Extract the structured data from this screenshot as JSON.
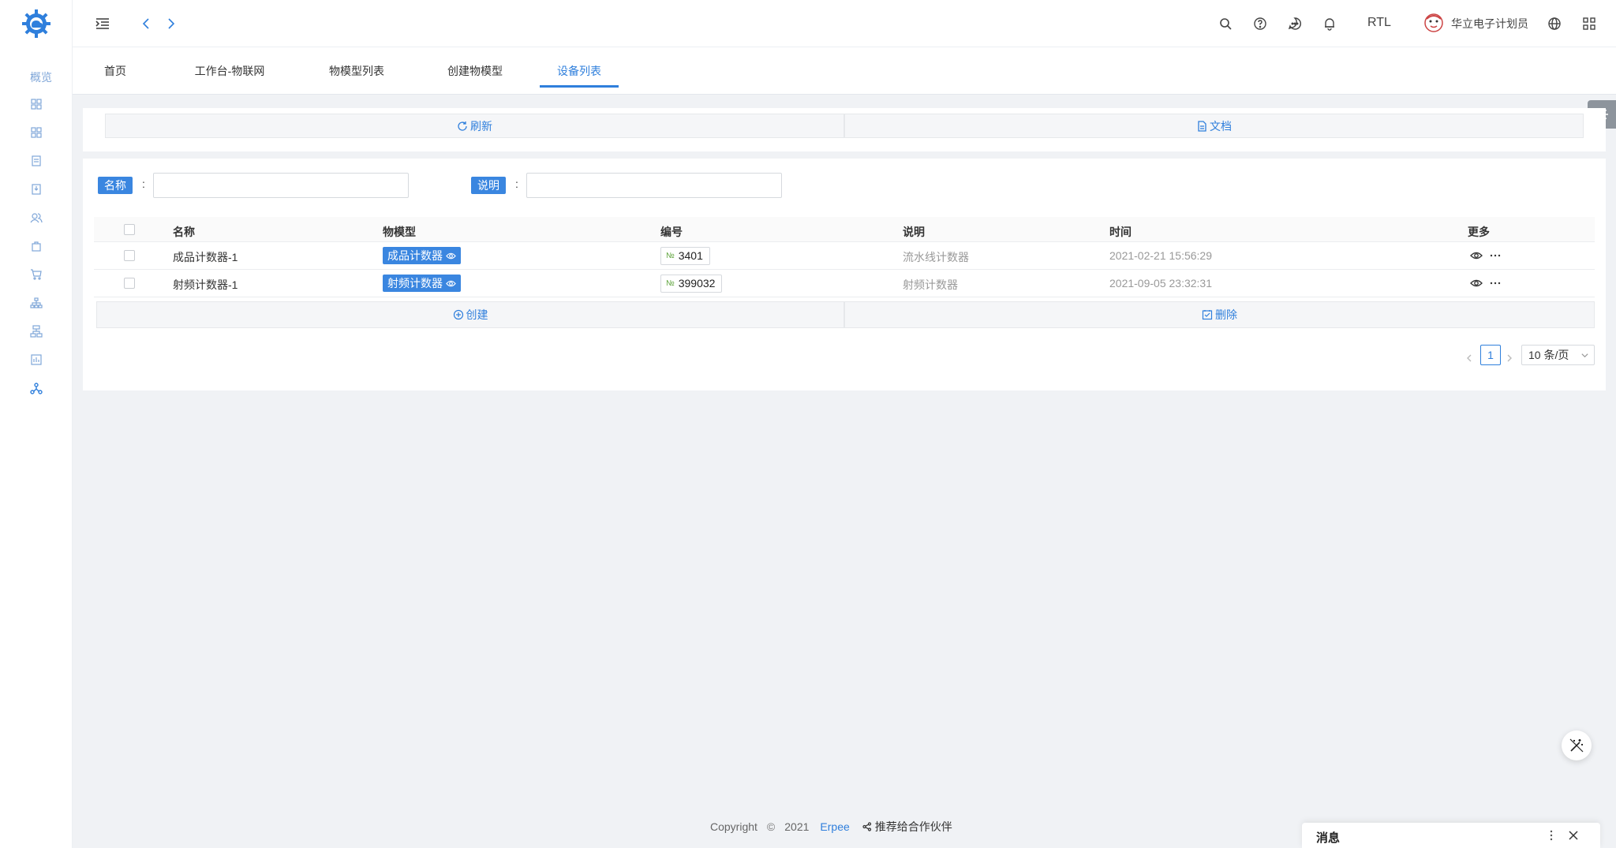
{
  "colors": {
    "primary": "#2f7fdc",
    "tag": "#3a86e0",
    "background": "#f0f2f5"
  },
  "sidebar": {
    "overview_label": "概览",
    "icons": [
      "dashboard-icon",
      "grid-icon",
      "document-icon",
      "download-icon",
      "users-icon",
      "bag-icon",
      "cart-icon",
      "org-icon",
      "structure-icon",
      "chart-icon",
      "network-icon"
    ]
  },
  "header": {
    "rtl_label": "RTL",
    "user_name": "华立电子计划员"
  },
  "tabs": [
    {
      "label": "首页"
    },
    {
      "label": "工作台-物联网"
    },
    {
      "label": "物模型列表"
    },
    {
      "label": "创建物模型"
    },
    {
      "label": "设备列表",
      "active": true
    }
  ],
  "toolbar": {
    "refresh_label": "刷新",
    "docs_label": "文档"
  },
  "filters": {
    "name_label": "名称",
    "name_value": "",
    "desc_label": "说明",
    "desc_value": "",
    "colon": ":"
  },
  "table": {
    "columns": [
      "名称",
      "物模型",
      "编号",
      "说明",
      "时间",
      "更多"
    ],
    "rows": [
      {
        "name": "成品计数器-1",
        "model": "成品计数器",
        "code_prefix": "№",
        "code": "3401",
        "desc": "流水线计数器",
        "time": "2021-02-21 15:56:29"
      },
      {
        "name": "射频计数器-1",
        "model": "射频计数器",
        "code_prefix": "№",
        "code": "399032",
        "desc": "射频计数器",
        "time": "2021-09-05 23:32:31"
      }
    ]
  },
  "actions": {
    "create_label": "创建",
    "delete_label": "删除"
  },
  "pagination": {
    "current": "1",
    "page_size": "10 条/页"
  },
  "footer": {
    "copyright": "Copyright",
    "copy_symbol": "©",
    "year": "2021",
    "brand": "Erpee",
    "partner": "推荐给合作伙伴"
  },
  "message_panel": {
    "title": "消息"
  }
}
